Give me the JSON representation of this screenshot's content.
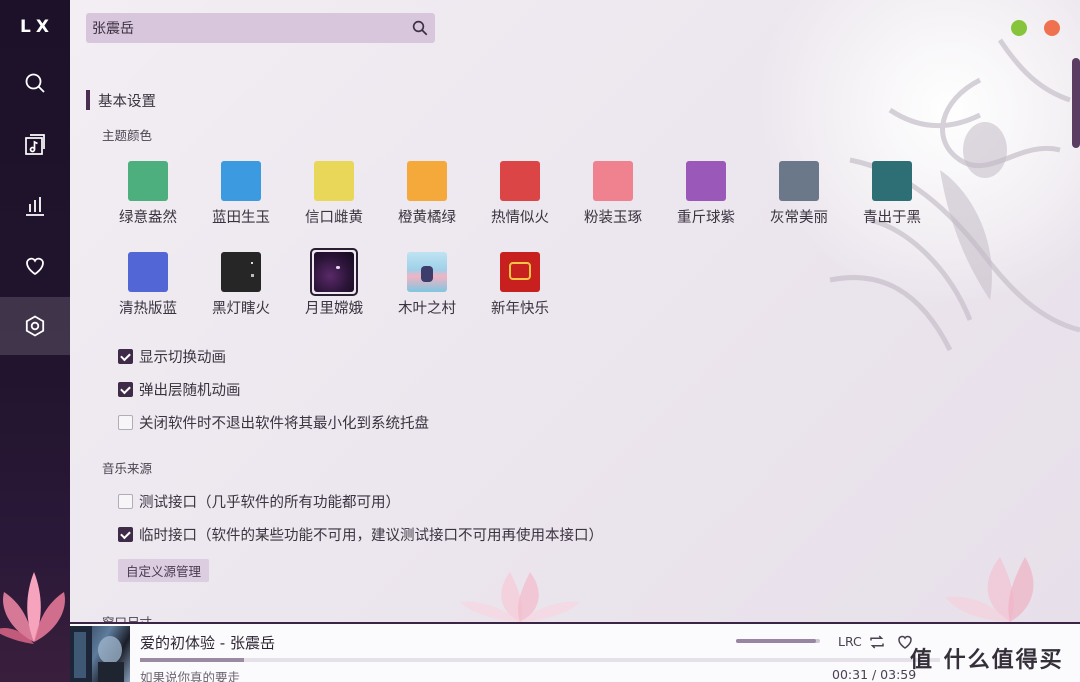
{
  "app": {
    "logo": "LX"
  },
  "sidebar": {
    "items": [
      {
        "name": "search",
        "icon": "search-icon"
      },
      {
        "name": "song-list",
        "icon": "music-list-icon"
      },
      {
        "name": "leaderboard",
        "icon": "chart-bars-icon"
      },
      {
        "name": "favorites",
        "icon": "heart-icon"
      },
      {
        "name": "settings",
        "icon": "settings-icon",
        "active": true
      }
    ]
  },
  "search": {
    "value": "张震岳"
  },
  "settings": {
    "section_title": "基本设置",
    "theme_title": "主题颜色",
    "themes": [
      {
        "label": "绿意盎然",
        "color": "#4caf7d"
      },
      {
        "label": "蓝田生玉",
        "color": "#3b9ae0"
      },
      {
        "label": "信口雌黄",
        "color": "#e9d75a"
      },
      {
        "label": "橙黄橘绿",
        "color": "#f5a93a"
      },
      {
        "label": "热情似火",
        "color": "#dc4545"
      },
      {
        "label": "粉装玉琢",
        "color": "#f0828f"
      },
      {
        "label": "重斤球紫",
        "color": "#9a58b8"
      },
      {
        "label": "灰常美丽",
        "color": "#6b7889"
      },
      {
        "label": "青出于黑",
        "color": "#2e6f76"
      },
      {
        "label": "清热版蓝",
        "color": "#5266d6"
      },
      {
        "label": "黑灯瞎火",
        "color": "#262626"
      },
      {
        "label": "月里嫦娥",
        "color": "#2b1438",
        "selected": true
      },
      {
        "label": "木叶之村",
        "color": "#9fd0e8"
      },
      {
        "label": "新年快乐",
        "color": "#c81f1f"
      }
    ],
    "options": [
      {
        "label": "显示切换动画",
        "checked": true
      },
      {
        "label": "弹出层随机动画",
        "checked": true
      },
      {
        "label": "关闭软件时不退出软件将其最小化到系统托盘",
        "checked": false
      }
    ],
    "source_title": "音乐来源",
    "sources": [
      {
        "label": "测试接口（几乎软件的所有功能都可用）",
        "checked": false
      },
      {
        "label": "临时接口（软件的某些功能不可用，建议测试接口不可用再使用本接口）",
        "checked": true
      }
    ],
    "custom_source_button": "自定义源管理",
    "window_size_title": "窗口尺寸"
  },
  "player": {
    "song": "爱的初体验 - 张震岳",
    "lyric": "如果说你真的要走",
    "time": "00:31 / 03:59",
    "progress": 0.13,
    "volume": 0.95,
    "lrc_label": "LRC",
    "watermark": "值 什么值得买"
  }
}
